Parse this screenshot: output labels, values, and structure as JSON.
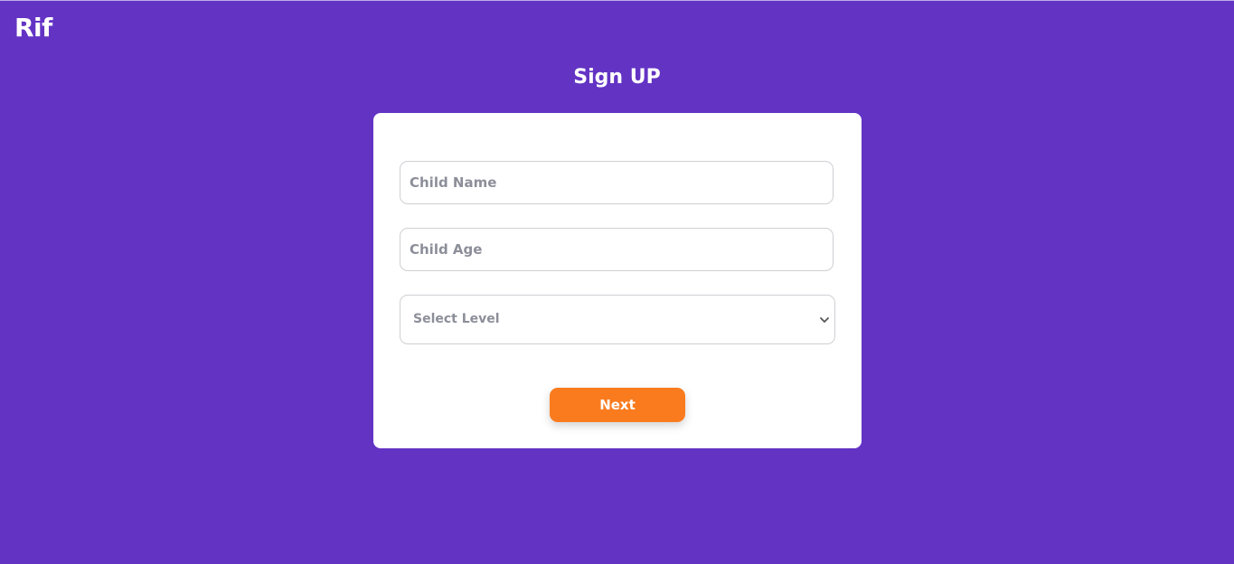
{
  "app": {
    "logo_text": "Rif"
  },
  "page": {
    "title": "Sign UP"
  },
  "form": {
    "child_name": {
      "placeholder": "Child Name",
      "value": ""
    },
    "child_age": {
      "placeholder": "Child Age",
      "value": ""
    },
    "level_select": {
      "selected_label": "Select Level",
      "icon": "chevron-down-icon"
    },
    "next_label": "Next"
  },
  "colors": {
    "background": "#6333c4",
    "card": "#ffffff",
    "accent": "#f97b1e"
  }
}
